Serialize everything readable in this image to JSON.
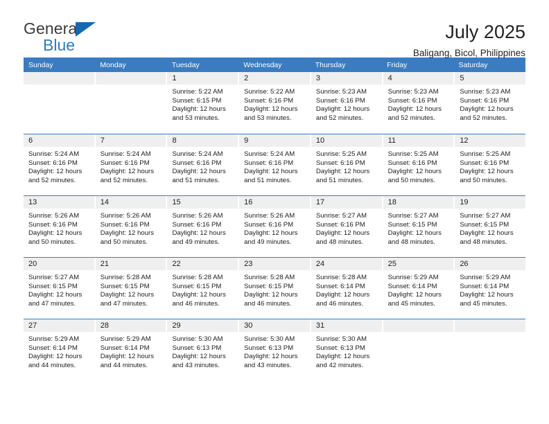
{
  "brand": {
    "name_top": "General",
    "name_bottom": "Blue",
    "accent_color": "#1567b2",
    "text_color": "#3b3b3b"
  },
  "header": {
    "title": "July 2025",
    "subtitle": "Baligang, Bicol, Philippines"
  },
  "theme": {
    "header_bg": "#3a7cbf",
    "daynum_bg": "#efefef",
    "page_bg": "#ffffff",
    "text": "#1d1d1d"
  },
  "weekdays": [
    "Sunday",
    "Monday",
    "Tuesday",
    "Wednesday",
    "Thursday",
    "Friday",
    "Saturday"
  ],
  "weeks": [
    [
      {
        "day": "",
        "empty": true
      },
      {
        "day": "",
        "empty": true
      },
      {
        "day": "1",
        "sunrise": "Sunrise: 5:22 AM",
        "sunset": "Sunset: 6:15 PM",
        "daylight1": "Daylight: 12 hours",
        "daylight2": "and 53 minutes."
      },
      {
        "day": "2",
        "sunrise": "Sunrise: 5:22 AM",
        "sunset": "Sunset: 6:16 PM",
        "daylight1": "Daylight: 12 hours",
        "daylight2": "and 53 minutes."
      },
      {
        "day": "3",
        "sunrise": "Sunrise: 5:23 AM",
        "sunset": "Sunset: 6:16 PM",
        "daylight1": "Daylight: 12 hours",
        "daylight2": "and 52 minutes."
      },
      {
        "day": "4",
        "sunrise": "Sunrise: 5:23 AM",
        "sunset": "Sunset: 6:16 PM",
        "daylight1": "Daylight: 12 hours",
        "daylight2": "and 52 minutes."
      },
      {
        "day": "5",
        "sunrise": "Sunrise: 5:23 AM",
        "sunset": "Sunset: 6:16 PM",
        "daylight1": "Daylight: 12 hours",
        "daylight2": "and 52 minutes."
      }
    ],
    [
      {
        "day": "6",
        "sunrise": "Sunrise: 5:24 AM",
        "sunset": "Sunset: 6:16 PM",
        "daylight1": "Daylight: 12 hours",
        "daylight2": "and 52 minutes."
      },
      {
        "day": "7",
        "sunrise": "Sunrise: 5:24 AM",
        "sunset": "Sunset: 6:16 PM",
        "daylight1": "Daylight: 12 hours",
        "daylight2": "and 52 minutes."
      },
      {
        "day": "8",
        "sunrise": "Sunrise: 5:24 AM",
        "sunset": "Sunset: 6:16 PM",
        "daylight1": "Daylight: 12 hours",
        "daylight2": "and 51 minutes."
      },
      {
        "day": "9",
        "sunrise": "Sunrise: 5:24 AM",
        "sunset": "Sunset: 6:16 PM",
        "daylight1": "Daylight: 12 hours",
        "daylight2": "and 51 minutes."
      },
      {
        "day": "10",
        "sunrise": "Sunrise: 5:25 AM",
        "sunset": "Sunset: 6:16 PM",
        "daylight1": "Daylight: 12 hours",
        "daylight2": "and 51 minutes."
      },
      {
        "day": "11",
        "sunrise": "Sunrise: 5:25 AM",
        "sunset": "Sunset: 6:16 PM",
        "daylight1": "Daylight: 12 hours",
        "daylight2": "and 50 minutes."
      },
      {
        "day": "12",
        "sunrise": "Sunrise: 5:25 AM",
        "sunset": "Sunset: 6:16 PM",
        "daylight1": "Daylight: 12 hours",
        "daylight2": "and 50 minutes."
      }
    ],
    [
      {
        "day": "13",
        "sunrise": "Sunrise: 5:26 AM",
        "sunset": "Sunset: 6:16 PM",
        "daylight1": "Daylight: 12 hours",
        "daylight2": "and 50 minutes."
      },
      {
        "day": "14",
        "sunrise": "Sunrise: 5:26 AM",
        "sunset": "Sunset: 6:16 PM",
        "daylight1": "Daylight: 12 hours",
        "daylight2": "and 50 minutes."
      },
      {
        "day": "15",
        "sunrise": "Sunrise: 5:26 AM",
        "sunset": "Sunset: 6:16 PM",
        "daylight1": "Daylight: 12 hours",
        "daylight2": "and 49 minutes."
      },
      {
        "day": "16",
        "sunrise": "Sunrise: 5:26 AM",
        "sunset": "Sunset: 6:16 PM",
        "daylight1": "Daylight: 12 hours",
        "daylight2": "and 49 minutes."
      },
      {
        "day": "17",
        "sunrise": "Sunrise: 5:27 AM",
        "sunset": "Sunset: 6:16 PM",
        "daylight1": "Daylight: 12 hours",
        "daylight2": "and 48 minutes."
      },
      {
        "day": "18",
        "sunrise": "Sunrise: 5:27 AM",
        "sunset": "Sunset: 6:15 PM",
        "daylight1": "Daylight: 12 hours",
        "daylight2": "and 48 minutes."
      },
      {
        "day": "19",
        "sunrise": "Sunrise: 5:27 AM",
        "sunset": "Sunset: 6:15 PM",
        "daylight1": "Daylight: 12 hours",
        "daylight2": "and 48 minutes."
      }
    ],
    [
      {
        "day": "20",
        "sunrise": "Sunrise: 5:27 AM",
        "sunset": "Sunset: 6:15 PM",
        "daylight1": "Daylight: 12 hours",
        "daylight2": "and 47 minutes."
      },
      {
        "day": "21",
        "sunrise": "Sunrise: 5:28 AM",
        "sunset": "Sunset: 6:15 PM",
        "daylight1": "Daylight: 12 hours",
        "daylight2": "and 47 minutes."
      },
      {
        "day": "22",
        "sunrise": "Sunrise: 5:28 AM",
        "sunset": "Sunset: 6:15 PM",
        "daylight1": "Daylight: 12 hours",
        "daylight2": "and 46 minutes."
      },
      {
        "day": "23",
        "sunrise": "Sunrise: 5:28 AM",
        "sunset": "Sunset: 6:15 PM",
        "daylight1": "Daylight: 12 hours",
        "daylight2": "and 46 minutes."
      },
      {
        "day": "24",
        "sunrise": "Sunrise: 5:28 AM",
        "sunset": "Sunset: 6:14 PM",
        "daylight1": "Daylight: 12 hours",
        "daylight2": "and 46 minutes."
      },
      {
        "day": "25",
        "sunrise": "Sunrise: 5:29 AM",
        "sunset": "Sunset: 6:14 PM",
        "daylight1": "Daylight: 12 hours",
        "daylight2": "and 45 minutes."
      },
      {
        "day": "26",
        "sunrise": "Sunrise: 5:29 AM",
        "sunset": "Sunset: 6:14 PM",
        "daylight1": "Daylight: 12 hours",
        "daylight2": "and 45 minutes."
      }
    ],
    [
      {
        "day": "27",
        "sunrise": "Sunrise: 5:29 AM",
        "sunset": "Sunset: 6:14 PM",
        "daylight1": "Daylight: 12 hours",
        "daylight2": "and 44 minutes."
      },
      {
        "day": "28",
        "sunrise": "Sunrise: 5:29 AM",
        "sunset": "Sunset: 6:14 PM",
        "daylight1": "Daylight: 12 hours",
        "daylight2": "and 44 minutes."
      },
      {
        "day": "29",
        "sunrise": "Sunrise: 5:30 AM",
        "sunset": "Sunset: 6:13 PM",
        "daylight1": "Daylight: 12 hours",
        "daylight2": "and 43 minutes."
      },
      {
        "day": "30",
        "sunrise": "Sunrise: 5:30 AM",
        "sunset": "Sunset: 6:13 PM",
        "daylight1": "Daylight: 12 hours",
        "daylight2": "and 43 minutes."
      },
      {
        "day": "31",
        "sunrise": "Sunrise: 5:30 AM",
        "sunset": "Sunset: 6:13 PM",
        "daylight1": "Daylight: 12 hours",
        "daylight2": "and 42 minutes."
      },
      {
        "day": "",
        "empty": true
      },
      {
        "day": "",
        "empty": true
      }
    ]
  ]
}
